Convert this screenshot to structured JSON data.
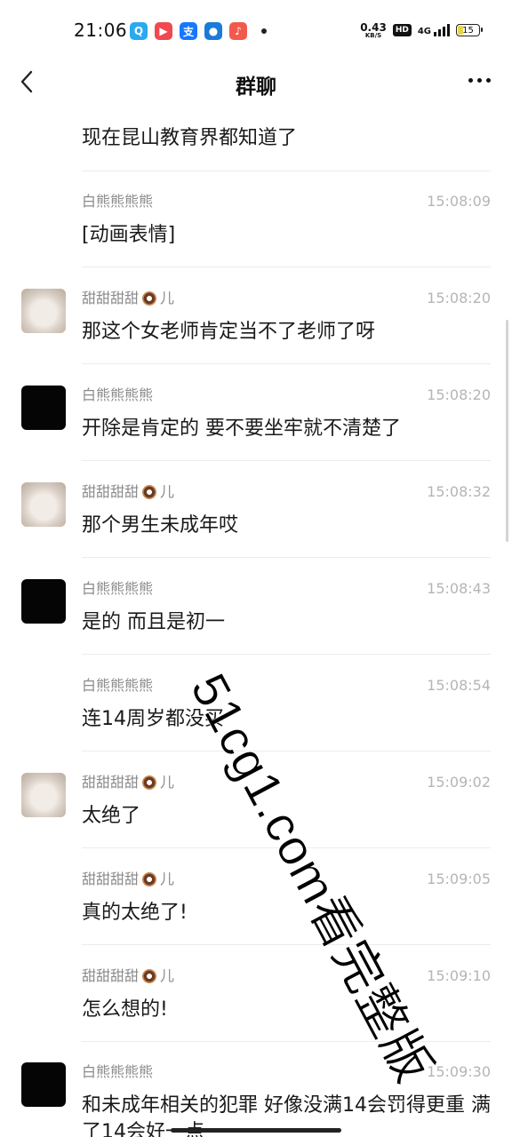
{
  "status_bar": {
    "time": "21:06",
    "apps": [
      {
        "icon": "qq-icon",
        "glyph": "Q",
        "color": "#2aa9f0"
      },
      {
        "icon": "video-icon",
        "glyph": "▶",
        "color": "#f04950"
      },
      {
        "icon": "alipay-icon",
        "glyph": "支",
        "color": "#1677ff"
      },
      {
        "icon": "circle-app-icon",
        "glyph": "●",
        "color": "#1a7bd9"
      },
      {
        "icon": "music-icon",
        "glyph": "♪",
        "color": "#f25a4e"
      }
    ],
    "net_speed": "0.43",
    "net_unit": "KB/S",
    "hd": "HD",
    "network": "4G",
    "battery": "15"
  },
  "header": {
    "title": "群聊"
  },
  "messages": [
    {
      "text": "现在昆山教育界都知道了"
    },
    {
      "sender": "白熊熊熊熊",
      "time": "15:08:09",
      "text": "[动画表情]"
    },
    {
      "sender": "甜甜甜甜",
      "suffix": "儿",
      "time": "15:08:20",
      "text": "那这个女老师肯定当不了老师了呀"
    },
    {
      "sender": "白熊熊熊熊",
      "time": "15:08:20",
      "text": "开除是肯定的 要不要坐牢就不清楚了"
    },
    {
      "sender": "甜甜甜甜",
      "suffix": "儿",
      "time": "15:08:32",
      "text": "那个男生未成年哎"
    },
    {
      "sender": "白熊熊熊熊",
      "time": "15:08:43",
      "text": "是的 而且是初一"
    },
    {
      "sender": "白熊熊熊熊",
      "time": "15:08:54",
      "text": "连14周岁都没买"
    },
    {
      "sender": "甜甜甜甜",
      "suffix": "儿",
      "time": "15:09:02",
      "text": "太绝了"
    },
    {
      "sender": "甜甜甜甜",
      "suffix": "儿",
      "time": "15:09:05",
      "text": "真的太绝了!"
    },
    {
      "sender": "甜甜甜甜",
      "suffix": "儿",
      "time": "15:09:10",
      "text": "怎么想的!"
    },
    {
      "sender": "白熊熊熊熊",
      "time": "15:09:30",
      "text": "和未成年相关的犯罪 好像没满14会罚得更重 满了14会好一点"
    }
  ],
  "watermark": "51cg1.com看完整版"
}
